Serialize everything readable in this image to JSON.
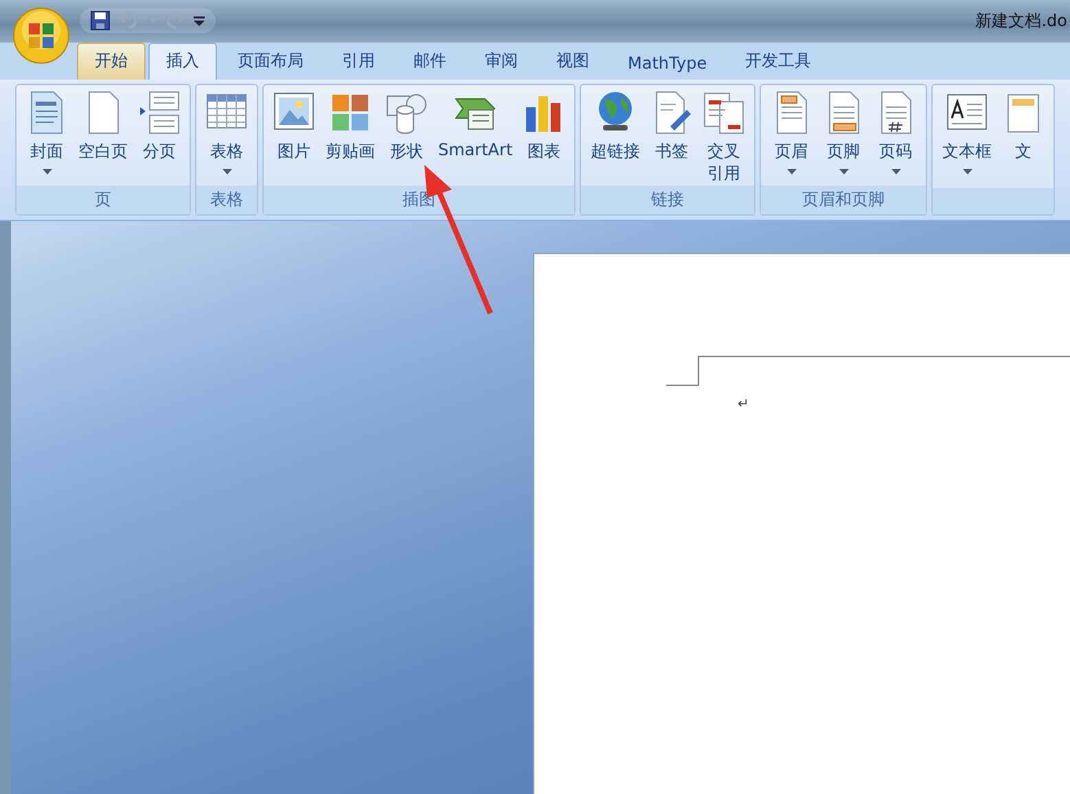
{
  "window": {
    "title": "新建文档.do"
  },
  "tabs": [
    {
      "label": "开始",
      "selected": false,
      "highlighted": true
    },
    {
      "label": "插入",
      "selected": true,
      "highlighted": false
    },
    {
      "label": "页面布局",
      "selected": false,
      "highlighted": false
    },
    {
      "label": "引用",
      "selected": false,
      "highlighted": false
    },
    {
      "label": "邮件",
      "selected": false,
      "highlighted": false
    },
    {
      "label": "审阅",
      "selected": false,
      "highlighted": false
    },
    {
      "label": "视图",
      "selected": false,
      "highlighted": false
    },
    {
      "label": "MathType",
      "selected": false,
      "highlighted": false
    },
    {
      "label": "开发工具",
      "selected": false,
      "highlighted": false
    }
  ],
  "ribbon_groups": [
    {
      "label": "页",
      "items": [
        {
          "kind": "cover",
          "label": "封面",
          "dropdown": true,
          "wrap": false
        },
        {
          "kind": "blank",
          "label": "空白页",
          "dropdown": false,
          "wrap": false
        },
        {
          "kind": "pagebreak",
          "label": "分页",
          "dropdown": false,
          "wrap": false
        }
      ]
    },
    {
      "label": "表格",
      "items": [
        {
          "kind": "table",
          "label": "表格",
          "dropdown": true,
          "wrap": false
        }
      ]
    },
    {
      "label": "插图",
      "items": [
        {
          "kind": "picture",
          "label": "图片",
          "dropdown": false,
          "wrap": false
        },
        {
          "kind": "clipart",
          "label": "剪贴画",
          "dropdown": false,
          "wrap": false
        },
        {
          "kind": "shapes",
          "label": "形状",
          "dropdown": false,
          "wrap": false
        },
        {
          "kind": "smartart",
          "label": "SmartArt",
          "dropdown": false,
          "wrap": false
        },
        {
          "kind": "chart",
          "label": "图表",
          "dropdown": false,
          "wrap": false
        }
      ]
    },
    {
      "label": "链接",
      "items": [
        {
          "kind": "globe",
          "label": "超链接",
          "dropdown": false,
          "wrap": false
        },
        {
          "kind": "bookmark",
          "label": "书签",
          "dropdown": false,
          "wrap": false
        },
        {
          "kind": "crossref",
          "label": "交叉引用",
          "dropdown": false,
          "wrap": true
        }
      ]
    },
    {
      "label": "页眉和页脚",
      "items": [
        {
          "kind": "header",
          "label": "页眉",
          "dropdown": true,
          "wrap": false
        },
        {
          "kind": "footer",
          "label": "页脚",
          "dropdown": true,
          "wrap": false
        },
        {
          "kind": "pagenum",
          "label": "页码",
          "dropdown": true,
          "wrap": false
        }
      ]
    },
    {
      "items": [
        {
          "kind": "textbox",
          "label": "文本框",
          "dropdown": true,
          "wrap": false
        },
        {
          "kind": "doc",
          "label": "文",
          "dropdown": false,
          "wrap": false
        }
      ]
    }
  ],
  "document": {
    "paragraph_mark": "↵"
  }
}
